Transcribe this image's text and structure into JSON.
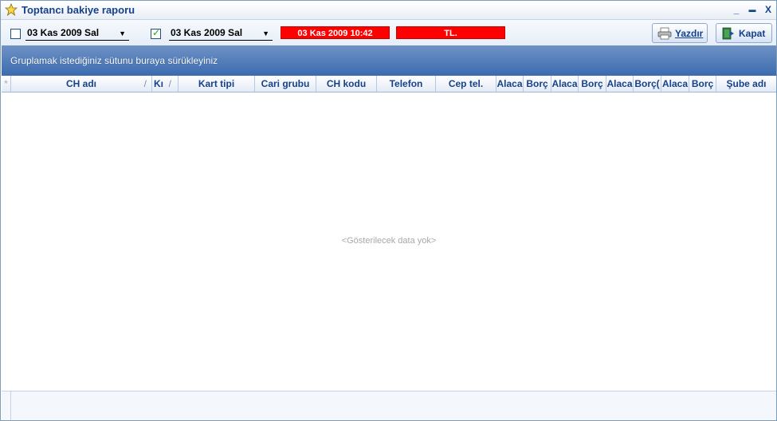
{
  "window": {
    "title": "Toptancı bakiye raporu",
    "minimize": "_",
    "maximize": "▬",
    "close": "X"
  },
  "toolbar": {
    "date1": {
      "checked": false,
      "value": "03 Kas 2009 Sal"
    },
    "date2": {
      "checked": true,
      "value": "03 Kas 2009 Sal"
    },
    "timestamp": "03 Kas 2009 10:42",
    "currency": "TL.",
    "print_label": "Yazdır",
    "close_label": "Kapat",
    "accent_red": "#ff0000"
  },
  "group_panel": {
    "text": "Gruplamak istediğiniz sütunu buraya sürükleyiniz"
  },
  "grid": {
    "columns": [
      "CH adı",
      "Kı",
      "Kart tipi",
      "Cari grubu",
      "CH kodu",
      "Telefon",
      "Cep tel.",
      "Alaca",
      "Borç",
      "Alaca",
      "Borç",
      "Alaca",
      "Borç(",
      "Alaca",
      "Borç",
      "Şube adı"
    ],
    "empty_text": "<Gösterilecek data yok>"
  }
}
